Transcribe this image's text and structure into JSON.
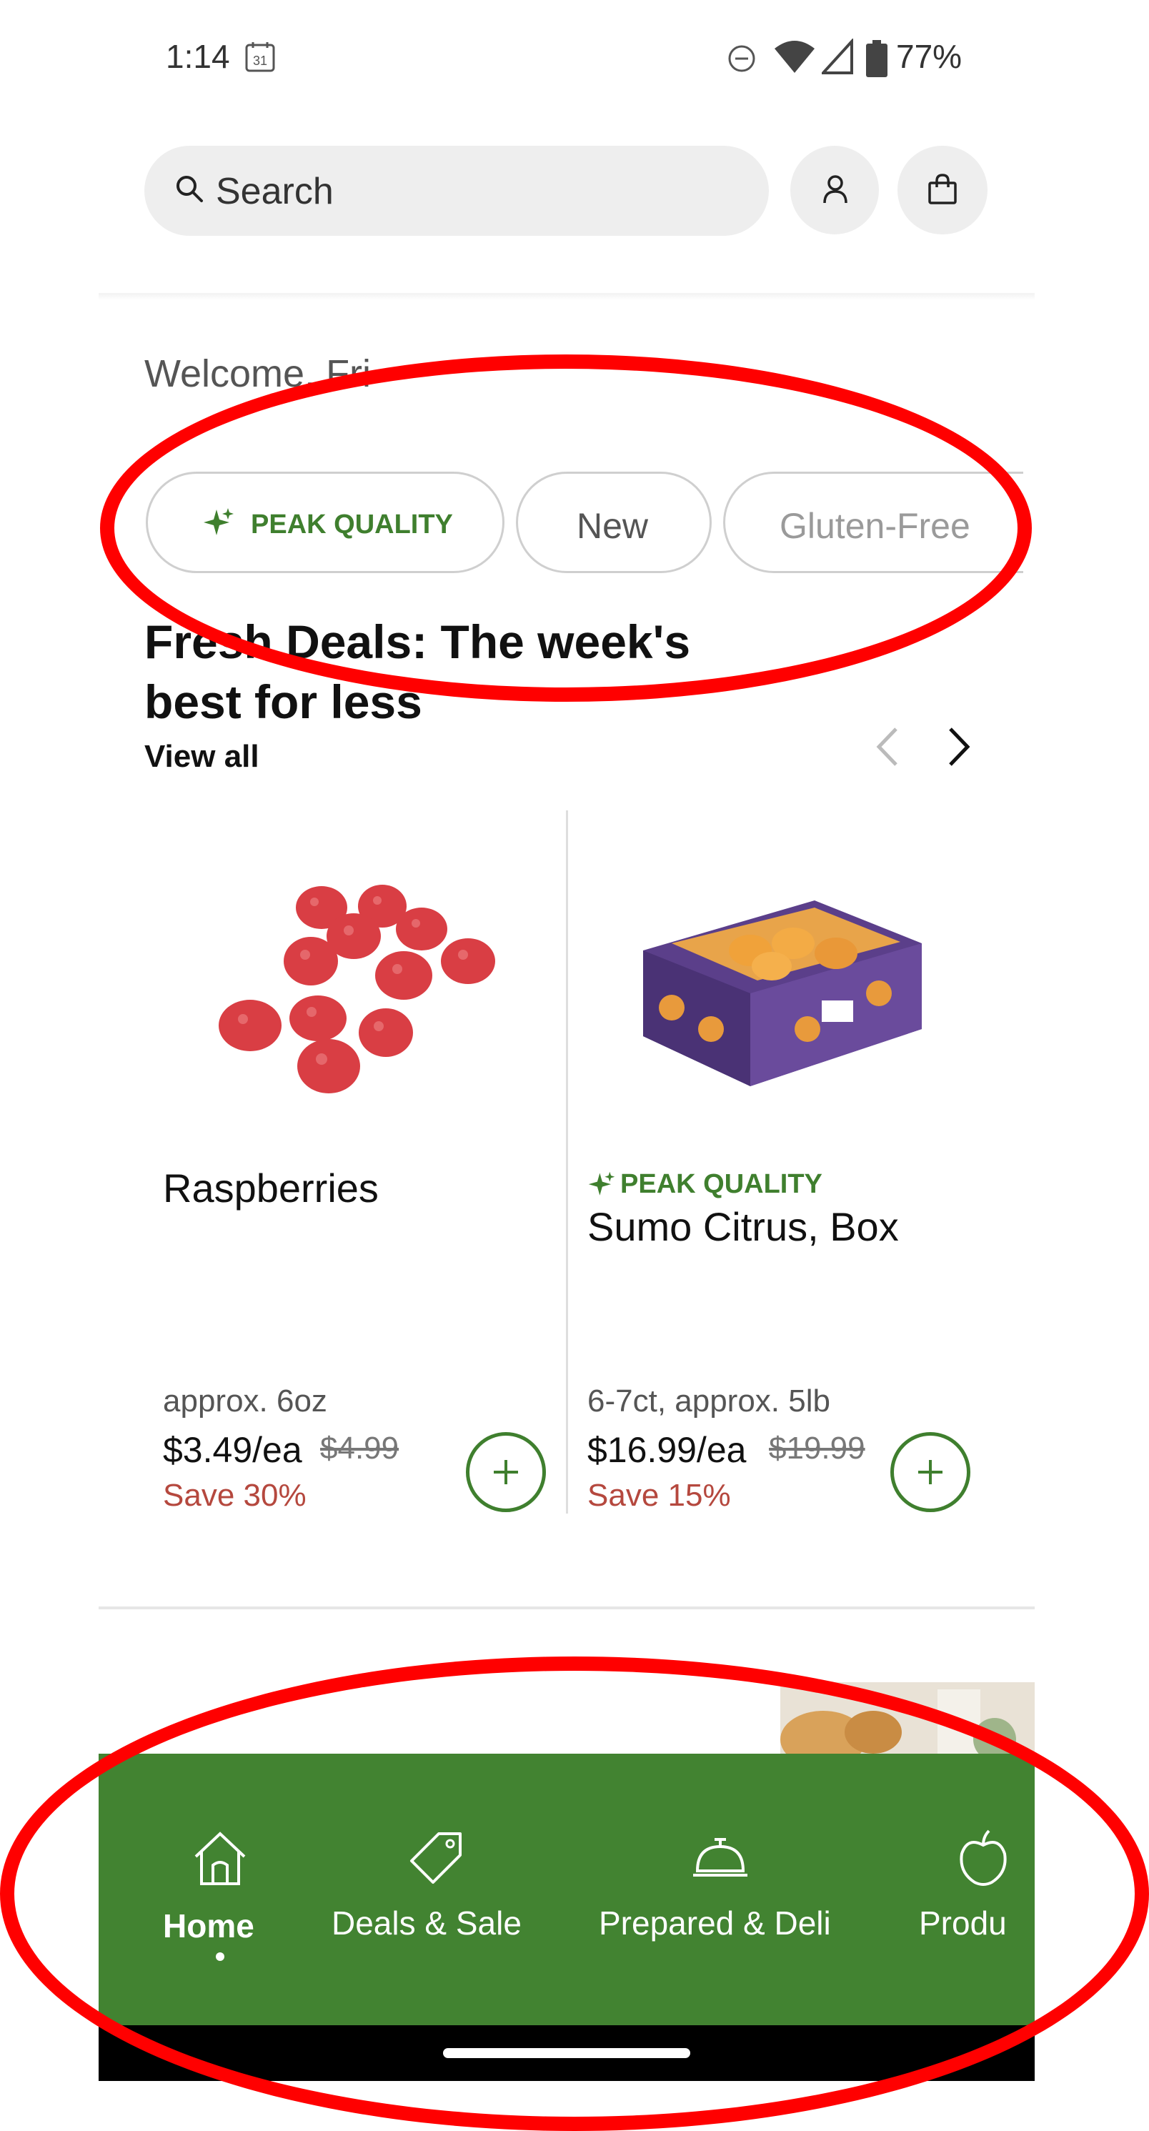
{
  "status_bar": {
    "time": "1:14",
    "calendar_day": "31",
    "battery": "77%"
  },
  "search": {
    "placeholder": "Search"
  },
  "welcome": "Welcome, Fri",
  "chips": [
    {
      "label": "PEAK QUALITY",
      "icon": "sparkle-icon"
    },
    {
      "label": "New"
    },
    {
      "label": "Gluten-Free"
    }
  ],
  "section": {
    "title": "Fresh Deals: The week's best for less",
    "view_all": "View all"
  },
  "products": [
    {
      "name": "Raspberries",
      "badge": "",
      "size": "approx. 6oz",
      "price": "$3.49/ea",
      "was_price": "$4.99",
      "save": "Save 30%"
    },
    {
      "name": "Sumo Citrus, Box",
      "badge": "PEAK QUALITY",
      "size": "6-7ct, approx. 5lb",
      "price": "$16.99/ea",
      "was_price": "$19.99",
      "save": "Save 15%"
    }
  ],
  "bottom_nav": [
    {
      "label": "Home",
      "icon": "home-icon",
      "active": true
    },
    {
      "label": "Deals & Sale",
      "icon": "tag-icon"
    },
    {
      "label": "Prepared & Deli",
      "icon": "cloche-icon"
    },
    {
      "label": "Produ",
      "icon": "apple-icon"
    }
  ],
  "colors": {
    "brand_green": "#428331",
    "peak_green": "#3f7f2e",
    "save_red": "#b5483e",
    "annotation_red": "#ff0000"
  }
}
